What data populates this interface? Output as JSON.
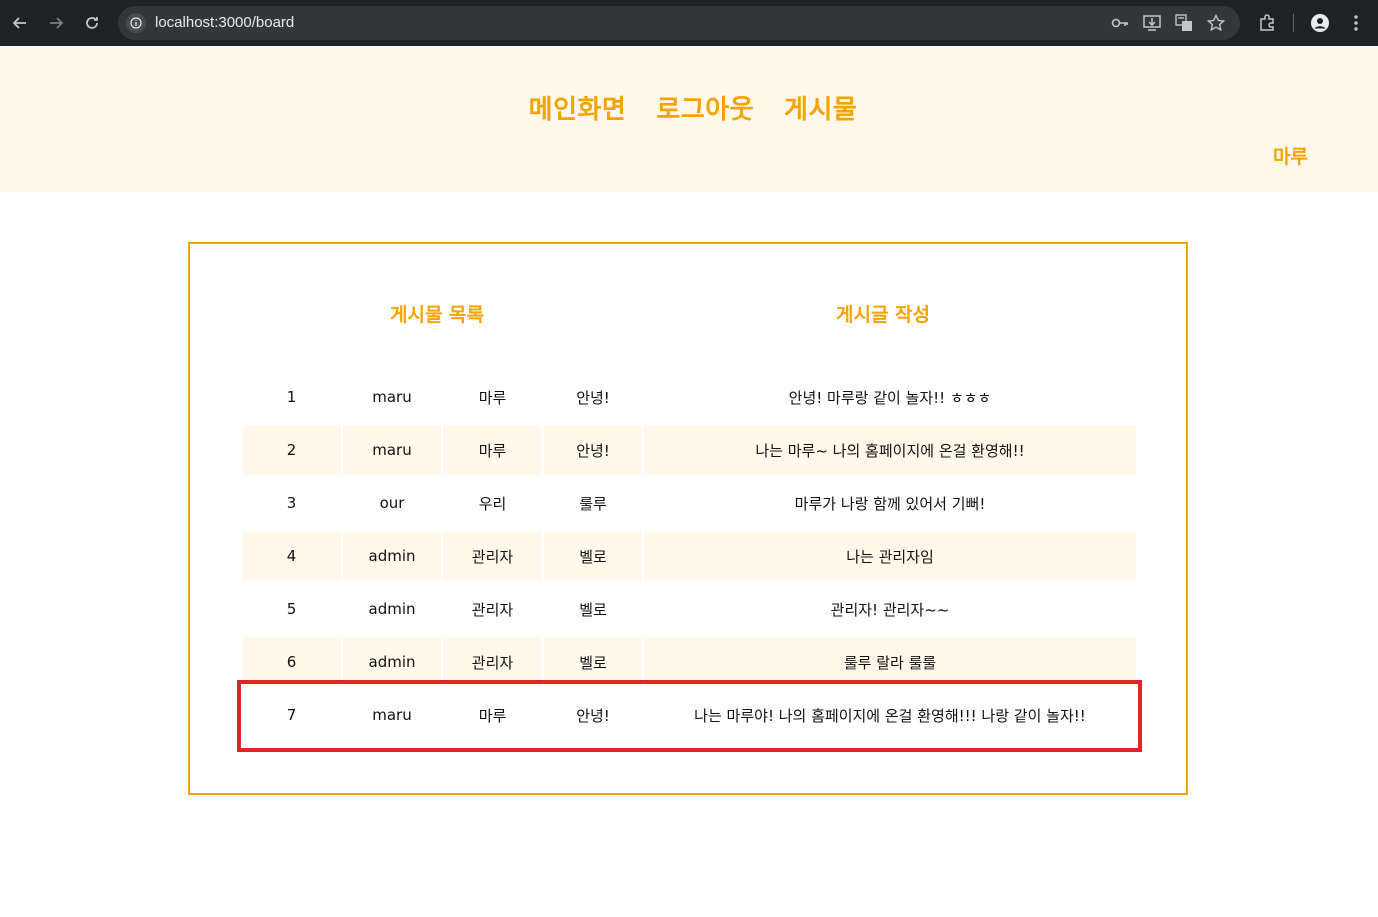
{
  "browser": {
    "url": "localhost:3000/board"
  },
  "header": {
    "nav": [
      {
        "label": "메인화면"
      },
      {
        "label": "로그아웃"
      },
      {
        "label": "게시물"
      }
    ],
    "user_name": "마루"
  },
  "board": {
    "tab_list": "게시물 목록",
    "tab_write": "게시글 작성",
    "posts": [
      {
        "no": "1",
        "user_id": "maru",
        "name": "마루",
        "title": "안녕!",
        "content": "안녕! 마루랑 같이 놀자!! ㅎㅎㅎ"
      },
      {
        "no": "2",
        "user_id": "maru",
        "name": "마루",
        "title": "안녕!",
        "content": "나는 마루~ 나의 홈페이지에 온걸 환영해!!"
      },
      {
        "no": "3",
        "user_id": "our",
        "name": "우리",
        "title": "룰루",
        "content": "마루가 나랑 함께 있어서 기뻐!"
      },
      {
        "no": "4",
        "user_id": "admin",
        "name": "관리자",
        "title": "벨로",
        "content": "나는 관리자임"
      },
      {
        "no": "5",
        "user_id": "admin",
        "name": "관리자",
        "title": "벨로",
        "content": "관리자! 관리자~~"
      },
      {
        "no": "6",
        "user_id": "admin",
        "name": "관리자",
        "title": "벨로",
        "content": "룰루 랄라 룰룰"
      },
      {
        "no": "7",
        "user_id": "maru",
        "name": "마루",
        "title": "안녕!",
        "content": "나는 마루야! 나의 홈페이지에 온걸 환영해!!! 나랑 같이 놀자!!"
      }
    ]
  },
  "colors": {
    "accent": "#f5a300",
    "header_bg": "#fff8eb",
    "highlight": "#e02424"
  }
}
